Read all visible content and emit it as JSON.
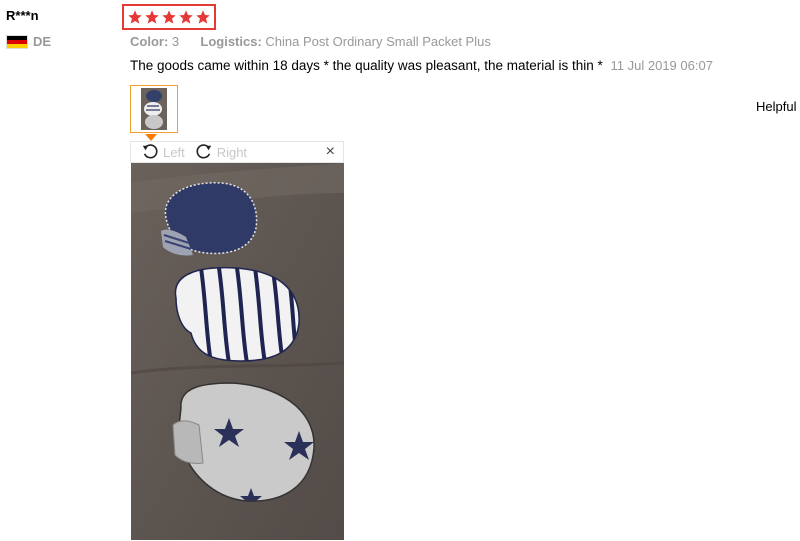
{
  "reviewer": {
    "name": "R***n",
    "country": "DE",
    "flag_colors": [
      "#000000",
      "#dd0000",
      "#ffce00"
    ]
  },
  "rating": {
    "stars": 5,
    "max": 5,
    "color": "#e53935",
    "border_color": "#e53935"
  },
  "meta": {
    "color_label": "Color:",
    "color_value": "3",
    "logistics_label": "Logistics:",
    "logistics_value": "China Post Ordinary Small Packet Plus"
  },
  "review": {
    "text": "The goods came within 18 days * the quality was pleasant, the material is thin *",
    "date": "11 Jul 2019 06:07"
  },
  "helpful_label": "Helpful",
  "viewer": {
    "rotate_left_label": "Left",
    "rotate_right_label": "Right",
    "close_label": "×"
  },
  "photo": {
    "description_icon": "product-photo-baby-mittens"
  }
}
